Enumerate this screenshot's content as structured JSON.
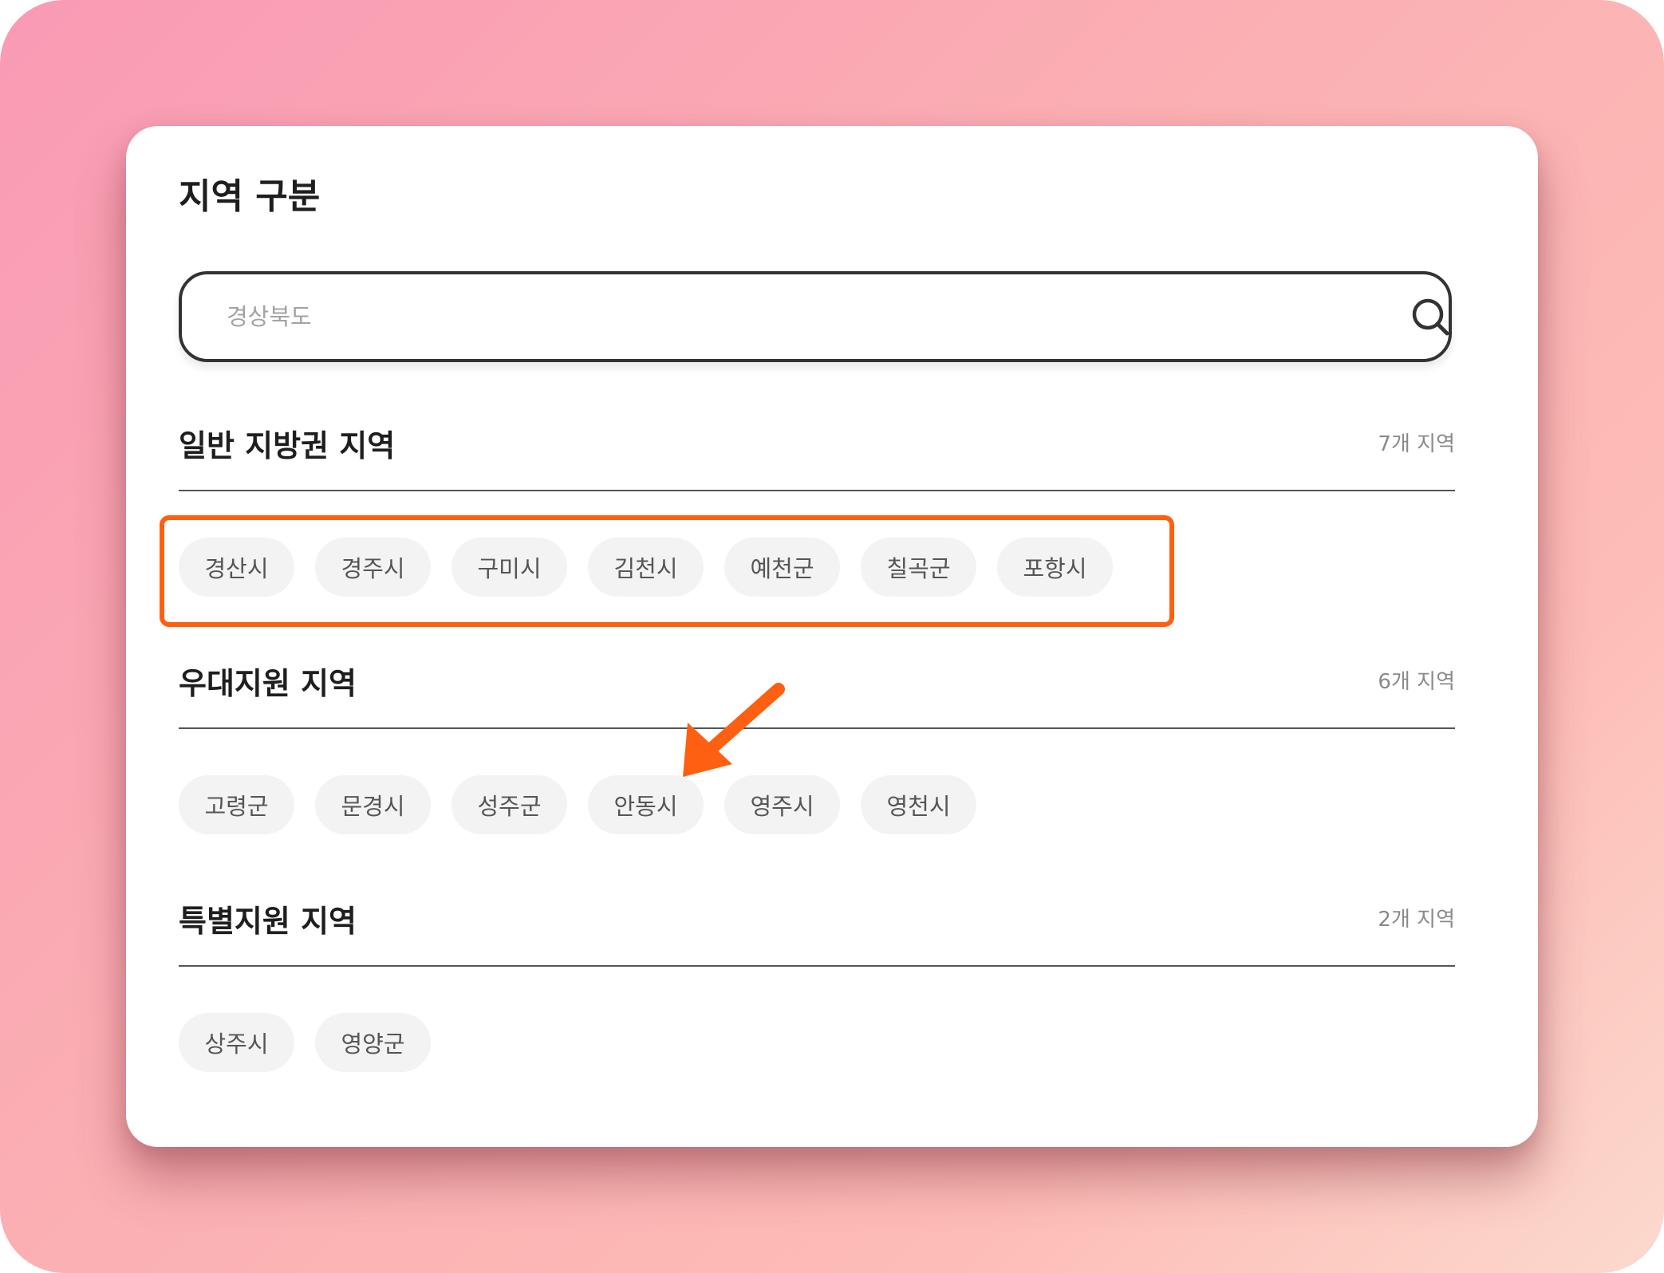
{
  "page": {
    "title": "지역 구분"
  },
  "search": {
    "placeholder": "경상북도",
    "value": ""
  },
  "sections": [
    {
      "title": "일반 지방권 지역",
      "count": "7개 지역",
      "chips": [
        "경산시",
        "경주시",
        "구미시",
        "김천시",
        "예천군",
        "칠곡군",
        "포항시"
      ]
    },
    {
      "title": "우대지원 지역",
      "count": "6개 지역",
      "chips": [
        "고령군",
        "문경시",
        "성주군",
        "안동시",
        "영주시",
        "영천시"
      ]
    },
    {
      "title": "특별지원 지역",
      "count": "2개 지역",
      "chips": [
        "상주시",
        "영양군"
      ]
    }
  ],
  "annotations": {
    "highlight_color": "#ff5f11",
    "arrow_color": "#ff5f11"
  },
  "icons": {
    "search": "search-icon",
    "arrow": "arrow-icon"
  }
}
